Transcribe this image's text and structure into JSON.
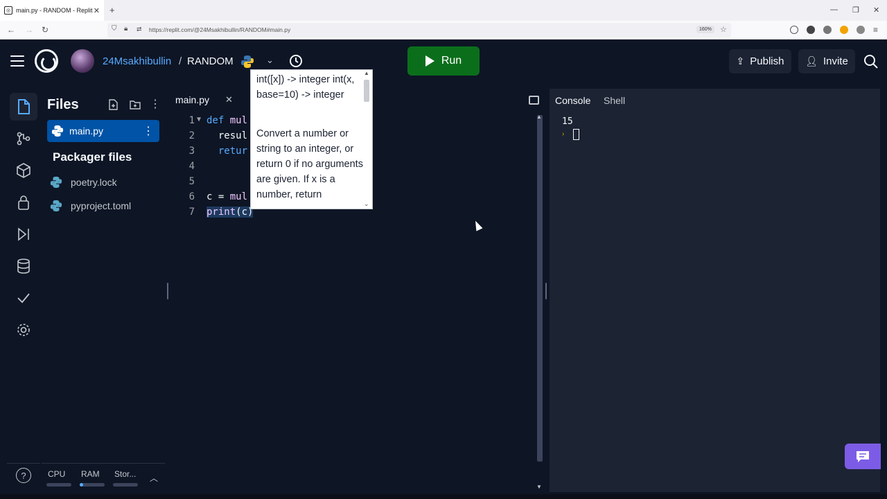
{
  "browser": {
    "tab_title": "main.py - RANDOM - Replit",
    "tab_close": "✕",
    "new_tab": "+",
    "url": "https://replit.com/@24Msakhibullin/RANDOM#main.py",
    "zoom": "160%"
  },
  "header": {
    "username": "24Msakhibullin",
    "separator": "/",
    "repl_name": "RANDOM",
    "run_label": "Run",
    "publish_label": "Publish",
    "invite_label": "Invite"
  },
  "files": {
    "title": "Files",
    "active_file": "main.py",
    "packager_title": "Packager files",
    "packager_items": [
      "poetry.lock",
      "pyproject.toml"
    ]
  },
  "resources": {
    "cpu": "CPU",
    "ram": "RAM",
    "storage": "Stor..."
  },
  "editor": {
    "tab_label": "main.py",
    "tab_close": "✕",
    "line_numbers": [
      "1",
      "2",
      "3",
      "4",
      "5",
      "6",
      "7"
    ]
  },
  "tooltip": {
    "signature": "int([x]) -> integer int(x, base=10) -> integer",
    "doc": "Convert a number or string to an integer, or return 0 if no arguments are given.  If x is a number, return"
  },
  "console": {
    "tab_console": "Console",
    "tab_shell": "Shell",
    "output": "15",
    "prompt": "›"
  },
  "colors": {
    "run_green": "#0b6e1b",
    "active_file_blue": "#0053a6",
    "username_blue": "#57abff",
    "chat_purple": "#7c5ce6"
  }
}
